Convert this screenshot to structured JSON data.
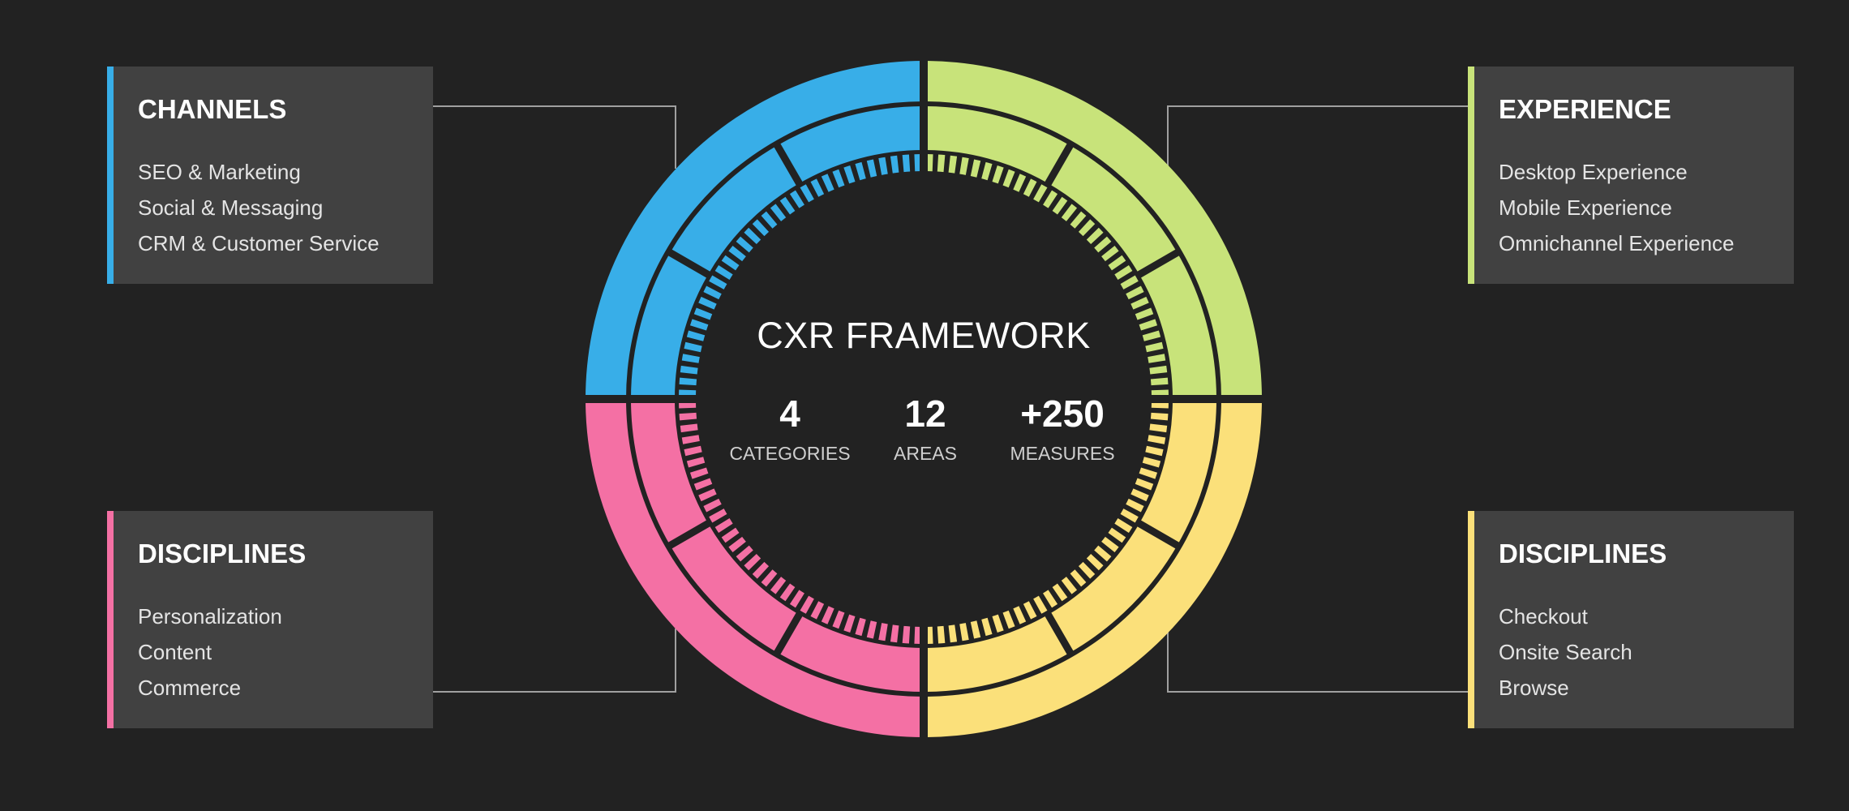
{
  "diagram": {
    "title": "CXR FRAMEWORK",
    "stats": [
      {
        "value": "4",
        "label": "CATEGORIES"
      },
      {
        "value": "12",
        "label": "AREAS"
      },
      {
        "value": "+250",
        "label": "MEASURES"
      }
    ],
    "background_color": "#222222",
    "card_color": "#414141",
    "connector_color": "#a0a0a0"
  },
  "categories": [
    {
      "id": "tl",
      "title": "CHANNELS",
      "color": "#38AEE8",
      "quadrant": "top-left",
      "items": [
        "SEO & Marketing",
        "Social & Messaging",
        "CRM & Customer Service"
      ]
    },
    {
      "id": "tr",
      "title": "EXPERIENCE",
      "color": "#C8E37A",
      "quadrant": "top-right",
      "items": [
        "Desktop Experience",
        "Mobile Experience",
        "Omnichannel Experience"
      ]
    },
    {
      "id": "bl",
      "title": "DISCIPLINES",
      "color": "#F470A4",
      "quadrant": "bottom-left",
      "items": [
        "Personalization",
        "Content",
        "Commerce"
      ]
    },
    {
      "id": "br",
      "title": "DISCIPLINES",
      "color": "#FBE07A",
      "quadrant": "bottom-right",
      "items": [
        "Checkout",
        "Onsite Search",
        "Browse"
      ]
    }
  ]
}
